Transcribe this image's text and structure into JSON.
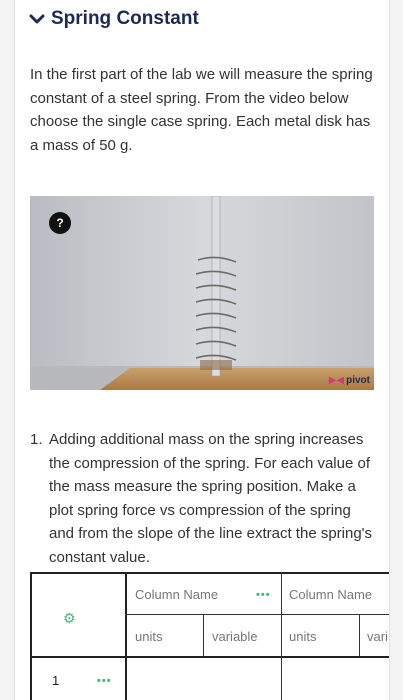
{
  "section": {
    "title": "Spring Constant",
    "chevron_icon": "chevron-down-icon"
  },
  "intro_text": "In the first part of the lab we will measure the spring constant of a steel spring. From the video below choose the single case spring. Each metal disk has a mass of 50 g.",
  "video": {
    "help_label": "?",
    "brand": "pivot"
  },
  "question": {
    "number": "1.",
    "text": "Adding additional mass on the spring increases the compression of the spring. For each value of the mass measure the spring position. Make a plot spring force vs compression of the spring and from the slope of the line extract the spring's constant value."
  },
  "table": {
    "columns": [
      {
        "name": "Column Name",
        "units": "units",
        "variable": "variable"
      },
      {
        "name": "Column Name",
        "units": "units",
        "variable": "vari"
      }
    ],
    "rows": [
      {
        "index": "1"
      }
    ],
    "accent": "#4db37d"
  }
}
